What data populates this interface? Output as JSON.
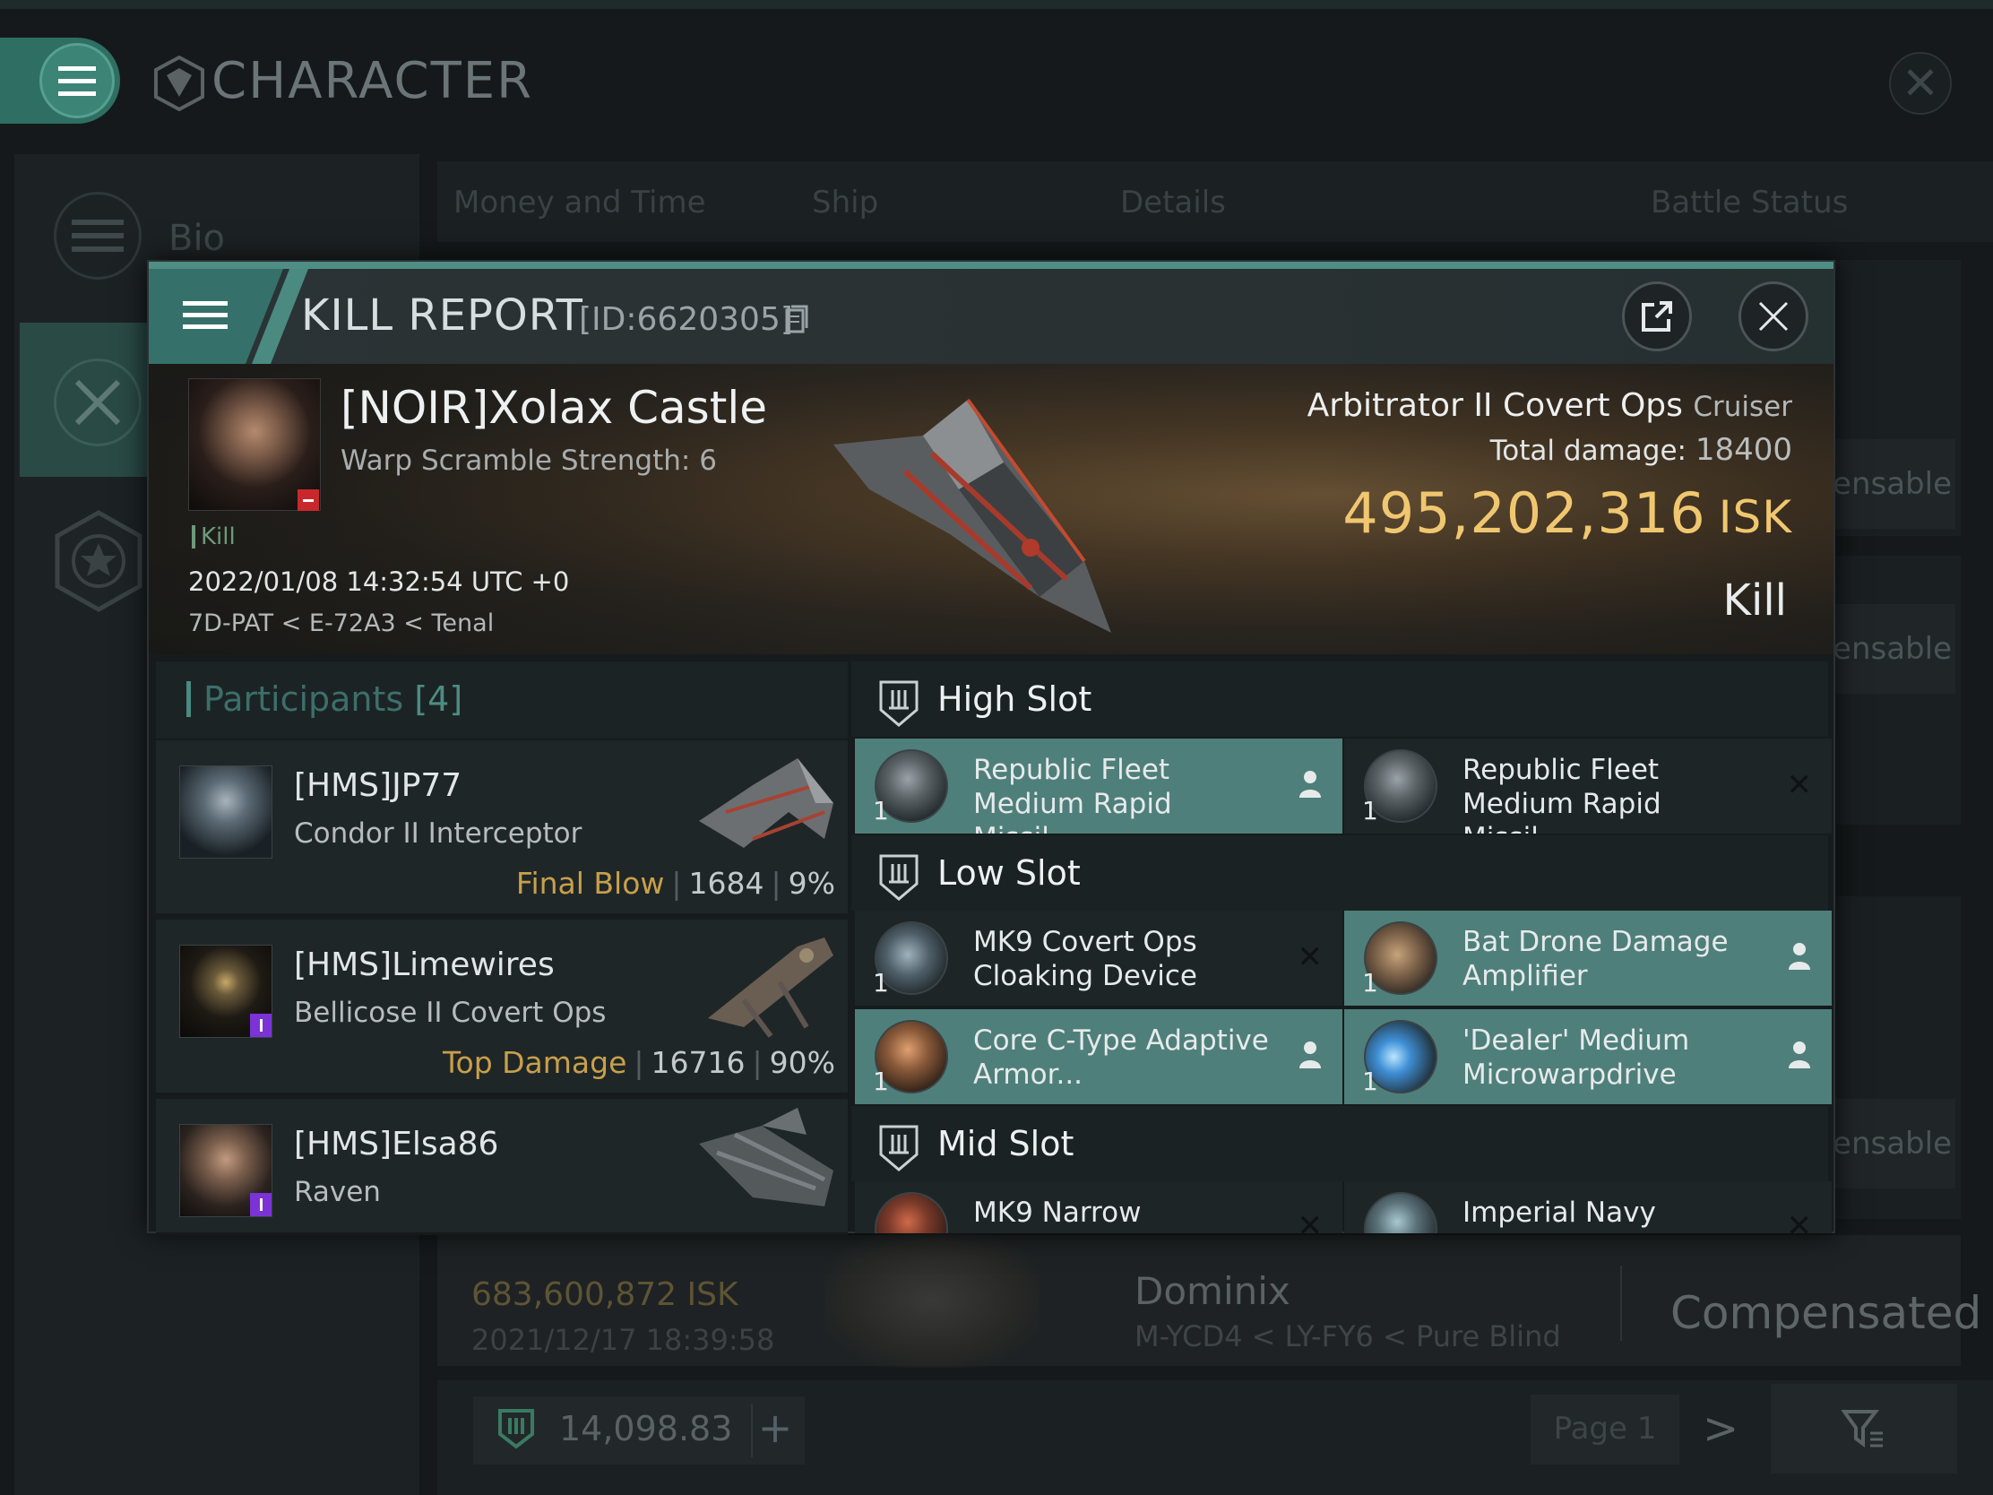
{
  "background": {
    "title": "CHARACTER",
    "rail": {
      "bio_label": "Bio"
    },
    "tabs": [
      "Money and Time",
      "Ship",
      "Details",
      "Battle Status"
    ],
    "compensable_label": "ensable",
    "row": {
      "isk": "683,600,872  ISK",
      "date": "2021/12/17  18:39:58",
      "ship": "Dominix",
      "location": "M-YCD4 < LY-FY6 < Pure Blind",
      "status": "Compensated"
    },
    "plex_value": "14,098.83",
    "page_label": "Page 1"
  },
  "report": {
    "title": "KILL REPORT",
    "id": "[ID:6620305]",
    "victim": {
      "name": "[NOIR]Xolax Castle",
      "warp": "Warp Scramble Strength: 6",
      "tag": "Kill",
      "datetime": "2022/01/08 14:32:54 UTC +0",
      "location": "7D-PAT < E-72A3 < Tenal"
    },
    "ship": {
      "name": "Arbitrator II Covert Ops",
      "class": "Cruiser",
      "damage_label": "Total damage:",
      "damage_value": "18400",
      "isk_value": "495,202,316",
      "isk_unit": "ISK",
      "result": "Kill"
    },
    "participants": {
      "label": "Participants",
      "count": "[4]",
      "list": [
        {
          "name": "[HMS]JP77",
          "ship": "Condor II Interceptor",
          "label": "Final Blow",
          "damage": "1684",
          "percent": "9%"
        },
        {
          "name": "[HMS]Limewires",
          "ship": "Bellicose II Covert Ops",
          "label": "Top Damage",
          "damage": "16716",
          "percent": "90%"
        },
        {
          "name": "[HMS]Elsa86",
          "ship": "Raven"
        }
      ]
    },
    "slots": {
      "high": {
        "title": "High Slot",
        "items": [
          {
            "qty": "1",
            "name": "Republic Fleet Medium Rapid Missil..."
          },
          {
            "qty": "1",
            "name": "Republic Fleet Medium Rapid Missil..."
          }
        ]
      },
      "low": {
        "title": "Low Slot",
        "items": [
          {
            "qty": "1",
            "name": "MK9 Covert Ops Cloaking Device"
          },
          {
            "qty": "1",
            "name": "Bat Drone Damage Amplifier"
          },
          {
            "qty": "1",
            "name": "Core C-Type Adaptive Armor..."
          },
          {
            "qty": "1",
            "name": "'Dealer' Medium Microwarpdrive"
          }
        ]
      },
      "mid": {
        "title": "Mid Slot",
        "items": [
          {
            "name": "MK9 Narrow"
          },
          {
            "name": "Imperial Navy"
          }
        ]
      }
    }
  },
  "colors": {
    "accent": "#4e8e85",
    "highlight_slot": "#4f7f7a",
    "isk_gold": "#f0c770",
    "final_blow": "#c8a04a"
  }
}
